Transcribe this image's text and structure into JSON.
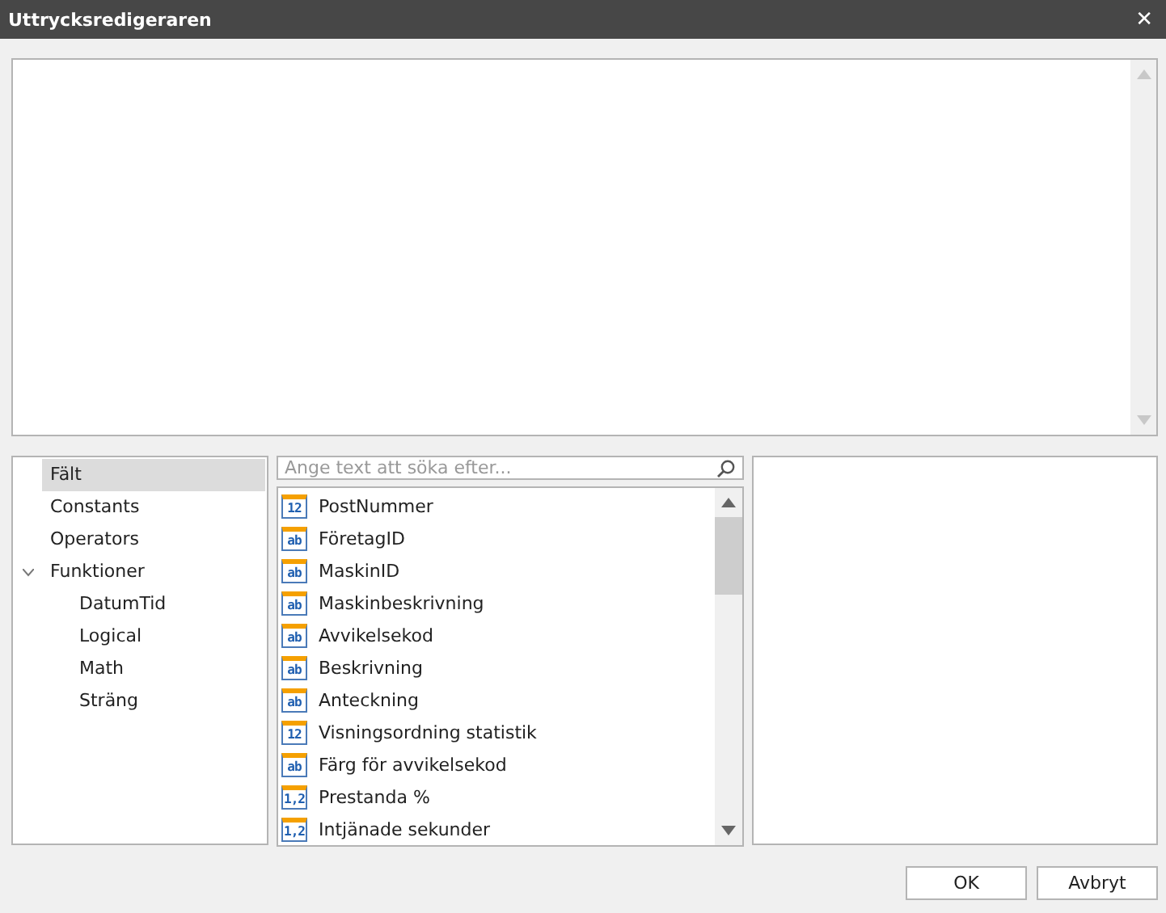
{
  "window": {
    "title": "Uttrycksredigeraren",
    "close": "✕"
  },
  "tree": [
    {
      "label": "Fält",
      "selected": true
    },
    {
      "label": "Constants",
      "selected": false
    },
    {
      "label": "Operators",
      "selected": false
    },
    {
      "label": "Funktioner",
      "selected": false,
      "expanded": true,
      "children": [
        {
          "label": "DatumTid",
          "selected": false
        },
        {
          "label": "Logical",
          "selected": false
        },
        {
          "label": "Math",
          "selected": false
        },
        {
          "label": "Sträng",
          "selected": false
        }
      ]
    }
  ],
  "search": {
    "placeholder": "Ange text att söka efter..."
  },
  "fields": [
    {
      "badge": "12",
      "label": "PostNummer"
    },
    {
      "badge": "ab",
      "label": "FöretagID"
    },
    {
      "badge": "ab",
      "label": "MaskinID"
    },
    {
      "badge": "ab",
      "label": "Maskinbeskrivning"
    },
    {
      "badge": "ab",
      "label": "Avvikelsekod"
    },
    {
      "badge": "ab",
      "label": "Beskrivning"
    },
    {
      "badge": "ab",
      "label": "Anteckning"
    },
    {
      "badge": "12",
      "label": "Visningsordning statistik"
    },
    {
      "badge": "ab",
      "label": "Färg för avvikelsekod"
    },
    {
      "badge": "1,2",
      "label": "Prestanda %"
    },
    {
      "badge": "1,2",
      "label": "Intjänade sekunder"
    }
  ],
  "buttons": [
    "OK",
    "Avbryt"
  ]
}
